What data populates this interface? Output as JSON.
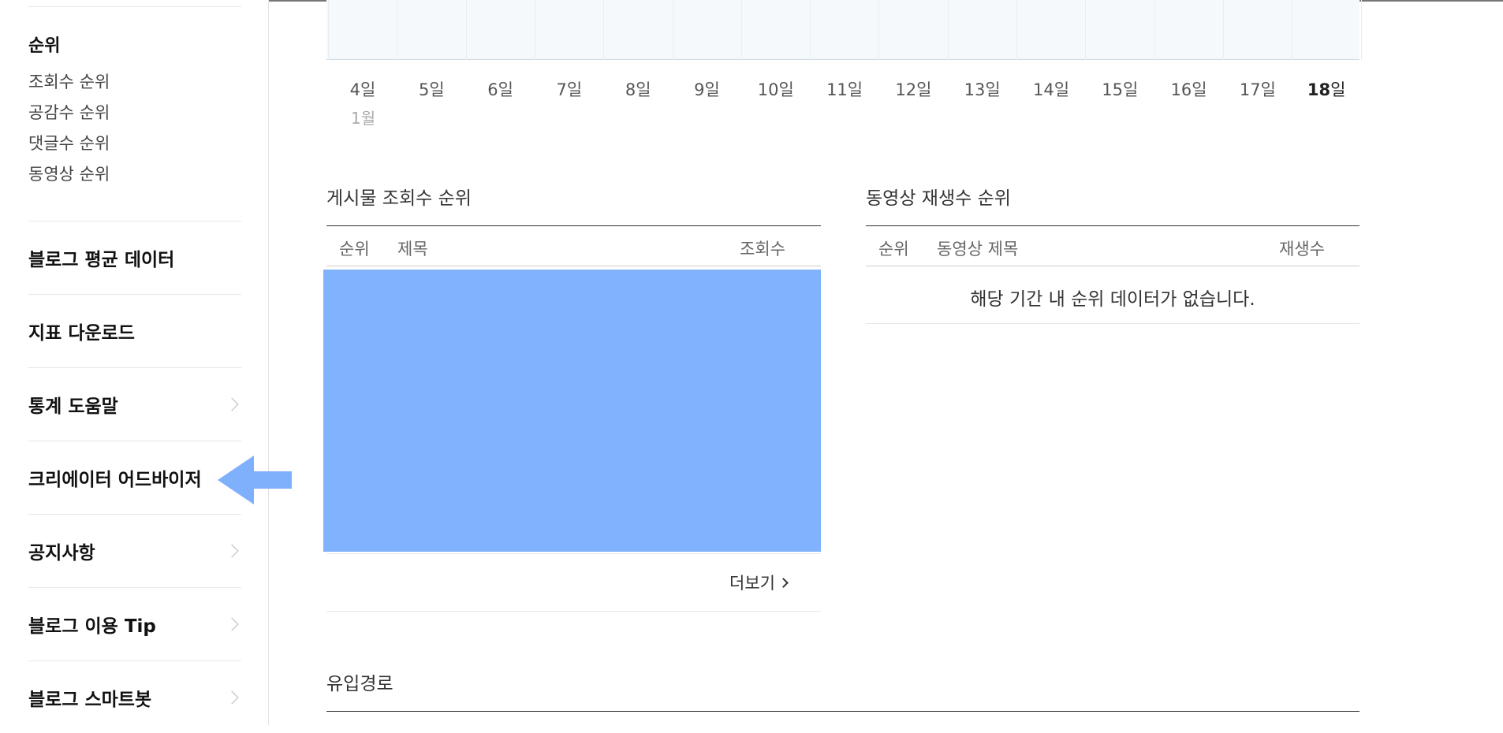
{
  "sidebar": {
    "rank_group": {
      "title": "순위",
      "items": [
        "조회수 순위",
        "공감수 순위",
        "댓글수 순위",
        "동영상 순위"
      ]
    },
    "menu": [
      {
        "label": "블로그 평균 데이터",
        "chevron": false
      },
      {
        "label": "지표 다운로드",
        "chevron": false
      },
      {
        "label": "통계 도움말",
        "chevron": true
      },
      {
        "label": "크리에이터 어드바이저",
        "chevron": false
      },
      {
        "label": "공지사항",
        "chevron": true
      },
      {
        "label": "블로그 이용 Tip",
        "chevron": true
      },
      {
        "label": "블로그 스마트봇",
        "chevron": true
      }
    ],
    "highlight_color": "#7fb0fb"
  },
  "chart": {
    "days": [
      "4일",
      "5일",
      "6일",
      "7일",
      "8일",
      "9일",
      "10일",
      "11일",
      "12일",
      "13일",
      "14일",
      "15일",
      "16일",
      "17일"
    ],
    "today_num": "18",
    "today_suffix": "일",
    "month": "1월"
  },
  "post_rank": {
    "title": "게시물 조회수 순위",
    "col_rank": "순위",
    "col_title": "제목",
    "col_views": "조회수",
    "more": "더보기",
    "redaction_color": "#80b2fe"
  },
  "video_rank": {
    "title": "동영상 재생수 순위",
    "col_rank": "순위",
    "col_title": "동영상 제목",
    "col_plays": "재생수",
    "empty": "해당 기간 내 순위 데이터가 없습니다."
  },
  "inflow": {
    "title": "유입경로"
  }
}
